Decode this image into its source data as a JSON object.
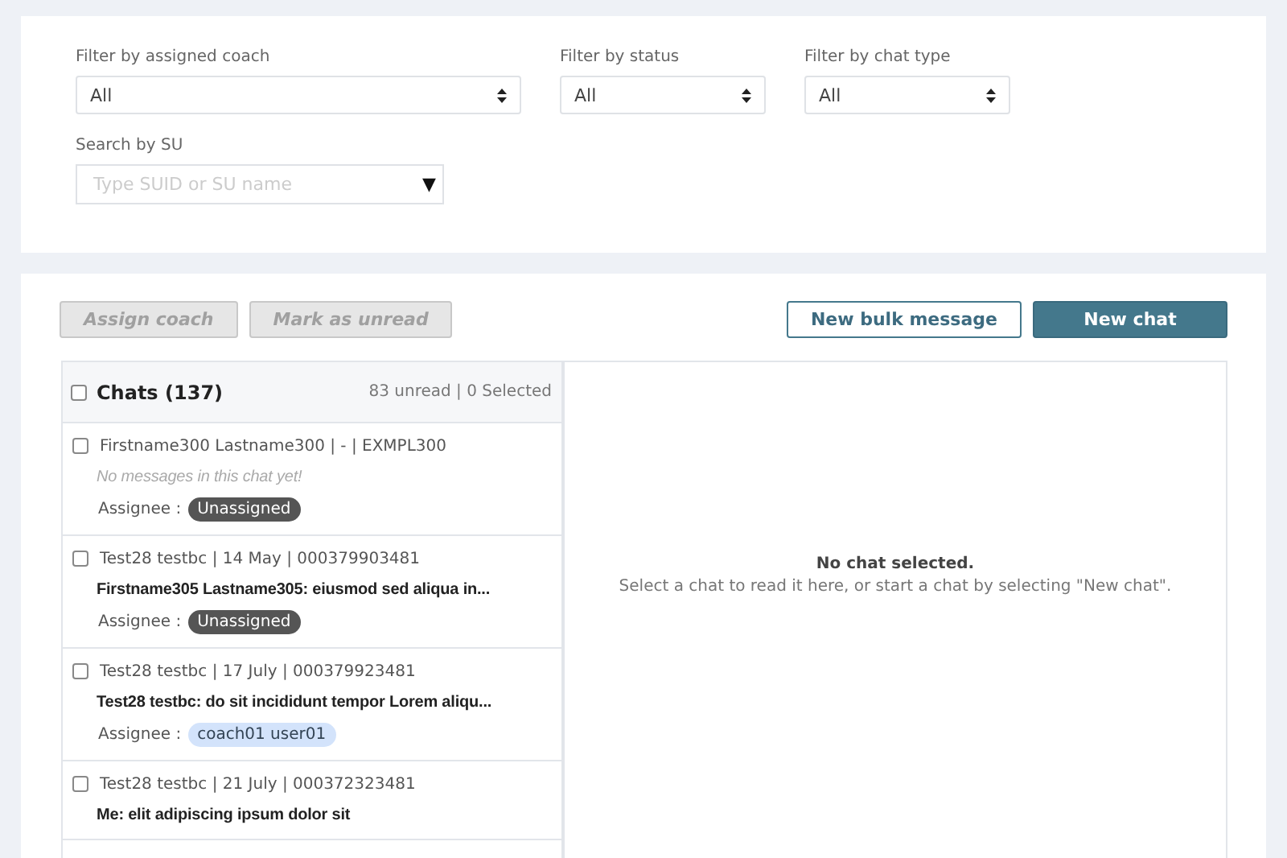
{
  "filters": [
    {
      "label": "Filter by assigned coach",
      "value": "All"
    },
    {
      "label": "Filter by status",
      "value": "All"
    },
    {
      "label": "Filter by chat type",
      "value": "All"
    }
  ],
  "search": {
    "label": "Search by SU",
    "placeholder": "Type SUID or SU name",
    "caret": "▼"
  },
  "actions": [
    {
      "label": "Assign coach",
      "disabled": true
    },
    {
      "label": "Mark as unread",
      "disabled": true
    }
  ],
  "primary_actions": [
    {
      "label": "New bulk message",
      "kind": "outline"
    },
    {
      "label": "New chat",
      "kind": "filled"
    }
  ],
  "chat_list": {
    "title": "Chats (137)",
    "checked": false,
    "summary": "83 unread | 0 Selected",
    "items": [
      {
        "meta": "Firstname300 Lastname300 | - | EXMPL300",
        "kind": "empty",
        "message": "No messages in this chat yet!",
        "assignee_label": "Assignee :",
        "assignee": "Unassigned",
        "assigned": false,
        "checked": false
      },
      {
        "meta": "Test28 testbc | 14 May | 000379903481",
        "kind": "message",
        "message": "Firstname305 Lastname305: eiusmod sed aliqua in...",
        "assignee_label": "Assignee :",
        "assignee": "Unassigned",
        "assigned": false,
        "checked": false
      },
      {
        "meta": "Test28 testbc | 17 July | 000379923481",
        "kind": "message",
        "message": "Test28 testbc: do sit incididunt tempor Lorem aliqu...",
        "assignee_label": "Assignee :",
        "assignee": "coach01 user01",
        "assigned": true,
        "checked": false
      },
      {
        "meta": "Test28 testbc | 21 July | 000372323481",
        "kind": "message",
        "message": "Me: elit adipiscing ipsum dolor sit",
        "checked": false
      }
    ]
  },
  "empty_state": {
    "title": "No chat selected.",
    "text": "Select a chat to read it here, or start a chat by selecting \"New chat\"."
  }
}
